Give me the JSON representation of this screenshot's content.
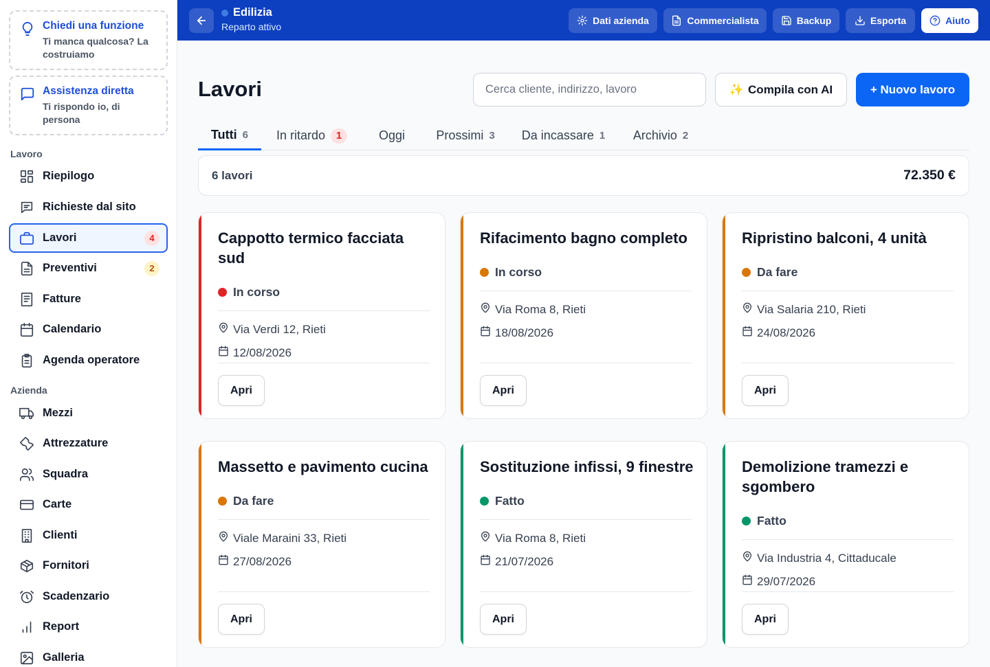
{
  "colors": {
    "topbar": "#0d3fc1",
    "primary": "#0b66f5",
    "status_red": "#dc2626",
    "status_orange": "#d97706",
    "status_green": "#059669"
  },
  "sidebar": {
    "promos": [
      {
        "icon": "lightbulb-icon",
        "title": "Chiedi una funzione",
        "subtitle": "Ti manca qualcosa? La costruiamo"
      },
      {
        "icon": "chat-bubble-icon",
        "title": "Assistenza diretta",
        "subtitle": "Ti rispondo io, di persona"
      }
    ],
    "section_work": "Lavoro",
    "section_company": "Azienda",
    "work_items": [
      {
        "label": "Riepilogo",
        "icon": "dashboard-icon",
        "badge": ""
      },
      {
        "label": "Richieste dal sito",
        "icon": "message-square-icon",
        "badge": ""
      },
      {
        "label": "Lavori",
        "icon": "briefcase-icon",
        "badge": "4",
        "active": true
      },
      {
        "label": "Preventivi",
        "icon": "file-text-icon",
        "badge": "2"
      },
      {
        "label": "Fatture",
        "icon": "receipt-icon",
        "badge": ""
      },
      {
        "label": "Calendario",
        "icon": "calendar-icon",
        "badge": ""
      },
      {
        "label": "Agenda operatore",
        "icon": "clipboard-icon",
        "badge": ""
      }
    ],
    "company_items": [
      {
        "label": "Mezzi",
        "icon": "truck-icon"
      },
      {
        "label": "Attrezzature",
        "icon": "wrench-icon"
      },
      {
        "label": "Squadra",
        "icon": "users-icon"
      },
      {
        "label": "Carte",
        "icon": "credit-card-icon"
      },
      {
        "label": "Clienti",
        "icon": "building-icon"
      },
      {
        "label": "Fornitori",
        "icon": "package-icon"
      },
      {
        "label": "Scadenzario",
        "icon": "alarm-clock-icon"
      },
      {
        "label": "Report",
        "icon": "bar-chart-icon"
      },
      {
        "label": "Galleria",
        "icon": "image-icon"
      }
    ]
  },
  "topbar": {
    "title": "Edilizia",
    "subtitle": "Reparto attivo",
    "buttons": [
      {
        "label": "Dati azienda",
        "icon": "settings-icon"
      },
      {
        "label": "Commercialista",
        "icon": "document-icon"
      },
      {
        "label": "Backup",
        "icon": "save-icon"
      },
      {
        "label": "Esporta",
        "icon": "download-icon"
      },
      {
        "label": "Aiuto",
        "icon": "help-circle-icon"
      }
    ]
  },
  "main": {
    "title": "Lavori",
    "search_placeholder": "Cerca cliente, indirizzo, lavoro",
    "ai_button_label": "Compila con AI",
    "ai_button_emoji": "✨",
    "new_button_label": "+ Nuovo lavoro",
    "tabs": [
      {
        "label": "Tutti",
        "count": "6",
        "active": true
      },
      {
        "label": "In ritardo",
        "count": "1",
        "alert": true
      },
      {
        "label": "Oggi",
        "count": ""
      },
      {
        "label": "Prossimi",
        "count": "3"
      },
      {
        "label": "Da incassare",
        "count": "1"
      },
      {
        "label": "Archivio",
        "count": "2"
      }
    ],
    "summary": {
      "count_label": "6 lavori",
      "total": "72.350 €"
    },
    "open_label": "Apri",
    "jobs": [
      {
        "title": "Cappotto termico facciata sud",
        "status": "In corso",
        "status_color": "#dc2626",
        "address": "Via Verdi 12, Rieti",
        "date": "12/08/2026"
      },
      {
        "title": "Rifacimento bagno completo",
        "status": "In corso",
        "status_color": "#d97706",
        "address": "Via Roma 8, Rieti",
        "date": "18/08/2026"
      },
      {
        "title": "Ripristino balconi, 4 unità",
        "status": "Da fare",
        "status_color": "#d97706",
        "address": "Via Salaria 210, Rieti",
        "date": "24/08/2026"
      },
      {
        "title": "Massetto e pavimento cucina",
        "status": "Da fare",
        "status_color": "#d97706",
        "address": "Viale Maraini 33, Rieti",
        "date": "27/08/2026"
      },
      {
        "title": "Sostituzione infissi, 9 finestre",
        "status": "Fatto",
        "status_color": "#059669",
        "address": "Via Roma 8, Rieti",
        "date": "21/07/2026"
      },
      {
        "title": "Demolizione tramezzi e sgombero",
        "status": "Fatto",
        "status_color": "#059669",
        "address": "Via Industria 4, Cittaducale",
        "date": "29/07/2026"
      }
    ]
  }
}
